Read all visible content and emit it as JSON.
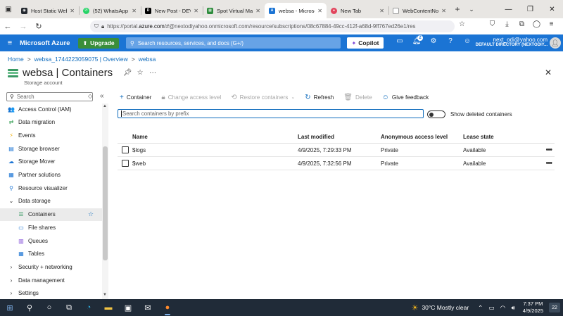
{
  "browser": {
    "tabs": [
      {
        "label": "Host Static Websi",
        "color": "#24292f",
        "active": false
      },
      {
        "label": "(52) WhatsApp",
        "color": "#25d366",
        "active": false
      },
      {
        "label": "New Post - DEV C",
        "color": "#000000",
        "active": false
      },
      {
        "label": "Spot Virtual Mach",
        "color": "#2d8c3c",
        "active": false
      },
      {
        "label": "websa - Microsof",
        "color": "#1b74d4",
        "active": true
      },
      {
        "label": "New Tab",
        "color": "#e2445c",
        "active": false
      },
      {
        "label": "WebContentNotFoun",
        "color": "#ffffff",
        "active": false
      }
    ],
    "url_prefix": "https://portal.",
    "url_host": "azure.com",
    "url_rest": "/#@nextodiyahoo.onmicrosoft.com/resource/subscriptions/08c67884-49cc-412f-a68d-9ff767ed26e1/res"
  },
  "azure": {
    "brand": "Microsoft Azure",
    "upgrade_label": "Upgrade",
    "search_placeholder": "Search resources, services, and docs (G+/)",
    "copilot_label": "Copilot",
    "notif_count": "2",
    "account_email": "next_odi@yahoo.com",
    "account_dir": "DEFAULT DIRECTORY (NEXTODIY..."
  },
  "breadcrumb": [
    "Home",
    "websa_1744223059075 | Overview",
    "websa"
  ],
  "page": {
    "title": "websa | Containers",
    "subtitle": "Storage account"
  },
  "sidebar": {
    "search_placeholder": "Search",
    "items": [
      {
        "label": "Access Control (IAM)",
        "icon": "people-icon",
        "glyph": "👥",
        "color": "#5c7dbf",
        "kind": "item"
      },
      {
        "label": "Data migration",
        "icon": "migration-icon",
        "glyph": "⇄",
        "color": "#2b9a4b",
        "kind": "item"
      },
      {
        "label": "Events",
        "icon": "lightning-icon",
        "glyph": "⚡",
        "color": "#f2b51d",
        "kind": "item"
      },
      {
        "label": "Storage browser",
        "icon": "storage-browser-icon",
        "glyph": "▤",
        "color": "#1b74d4",
        "kind": "item"
      },
      {
        "label": "Storage Mover",
        "icon": "storage-mover-icon",
        "glyph": "☁",
        "color": "#1b74d4",
        "kind": "item"
      },
      {
        "label": "Partner solutions",
        "icon": "partner-icon",
        "glyph": "▦",
        "color": "#1b74d4",
        "kind": "item"
      },
      {
        "label": "Resource visualizer",
        "icon": "visualizer-icon",
        "glyph": "⚲",
        "color": "#1b74d4",
        "kind": "item"
      },
      {
        "label": "Data storage",
        "icon": "chevron-down-icon",
        "glyph": "⌄",
        "color": "#333333",
        "kind": "group-open"
      },
      {
        "label": "Containers",
        "icon": "containers-icon",
        "glyph": "☰",
        "color": "#3a9a64",
        "kind": "child-selected"
      },
      {
        "label": "File shares",
        "icon": "file-shares-icon",
        "glyph": "▭",
        "color": "#1b74d4",
        "kind": "child"
      },
      {
        "label": "Queues",
        "icon": "queues-icon",
        "glyph": "▥",
        "color": "#7b43d6",
        "kind": "child"
      },
      {
        "label": "Tables",
        "icon": "tables-icon",
        "glyph": "▦",
        "color": "#1b74d4",
        "kind": "child"
      },
      {
        "label": "Security + networking",
        "icon": "chevron-right-icon",
        "glyph": "›",
        "color": "#333333",
        "kind": "group"
      },
      {
        "label": "Data management",
        "icon": "chevron-right-icon",
        "glyph": "›",
        "color": "#333333",
        "kind": "group"
      },
      {
        "label": "Settings",
        "icon": "chevron-right-icon",
        "glyph": "›",
        "color": "#333333",
        "kind": "group"
      }
    ]
  },
  "commands": {
    "add": "Container",
    "change_access": "Change access level",
    "restore": "Restore containers",
    "refresh": "Refresh",
    "delete": "Delete",
    "feedback": "Give feedback"
  },
  "filter": {
    "placeholder": "Search containers by prefix",
    "toggle_label": "Show deleted containers"
  },
  "table": {
    "headers": {
      "name": "Name",
      "modified": "Last modified",
      "anon": "Anonymous access level",
      "lease": "Lease state"
    },
    "rows": [
      {
        "name": "$logs",
        "modified": "4/9/2025, 7:29:33 PM",
        "anon": "Private",
        "lease": "Available"
      },
      {
        "name": "$web",
        "modified": "4/9/2025, 7:32:56 PM",
        "anon": "Private",
        "lease": "Available"
      }
    ]
  },
  "taskbar": {
    "weather": "30°C  Mostly clear",
    "time": "7:37 PM",
    "date": "4/9/2025",
    "notif": "22"
  }
}
